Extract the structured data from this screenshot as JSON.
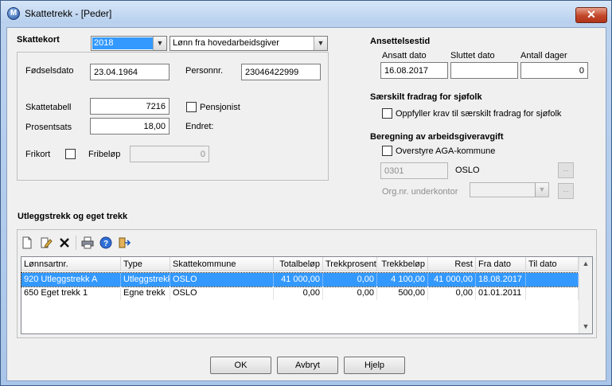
{
  "window": {
    "title": "Skattetrekk - [Peder]",
    "close_glyph": "✕"
  },
  "skattekort": {
    "title": "Skattekort",
    "year": "2018",
    "source": "Lønn fra hovedarbeidsgiver",
    "fodselsdato_label": "Fødselsdato",
    "fodselsdato": "23.04.1964",
    "personnr_label": "Personnr.",
    "personnr": "23046422999",
    "skattetabell_label": "Skattetabell",
    "skattetabell": "7216",
    "pensjonist_label": "Pensjonist",
    "prosentsats_label": "Prosentsats",
    "prosentsats": "18,00",
    "endret_label": "Endret:",
    "frikort_label": "Frikort",
    "fribelop_label": "Fribeløp",
    "fribelop": "0"
  },
  "ansettelse": {
    "title": "Ansettelsestid",
    "ansatt_label": "Ansatt dato",
    "sluttet_label": "Sluttet dato",
    "antall_label": "Antall dager",
    "ansatt": "16.08.2017",
    "sluttet": "",
    "antall": "0"
  },
  "sjofolk": {
    "title": "Særskilt fradrag for sjøfolk",
    "checkbox_label": "Oppfyller krav til særskilt fradrag for sjøfolk"
  },
  "aga": {
    "title": "Beregning av arbeidsgiveravgift",
    "checkbox_label": "Overstyre AGA-kommune",
    "kommune_nr": "0301",
    "kommune_navn": "OSLO",
    "orgnr_label": "Org.nr. underkontor",
    "browse_label": "..."
  },
  "utlegg": {
    "title": "Utleggstrekk og eget trekk",
    "columns": [
      "Lønnsartnr.",
      "Type",
      "Skattekommune",
      "Totalbeløp",
      "Trekkprosent",
      "Trekkbeløp",
      "Rest",
      "Fra dato",
      "Til dato"
    ],
    "rows": [
      [
        "920 Utleggstrekk A",
        "Utleggstrekk",
        "OSLO",
        "41 000,00",
        "0,00",
        "4 100,00",
        "41 000,00",
        "18.08.2017",
        ""
      ],
      [
        "650 Eget trekk 1",
        "Egne trekk",
        "OSLO",
        "0,00",
        "0,00",
        "500,00",
        "0,00",
        "01.01.2011",
        ""
      ]
    ]
  },
  "toolbar_icons": [
    "new-icon",
    "edit-icon",
    "delete-icon",
    "print-icon",
    "help-icon",
    "exit-icon"
  ],
  "buttons": {
    "ok": "OK",
    "cancel": "Avbryt",
    "help": "Hjelp"
  }
}
